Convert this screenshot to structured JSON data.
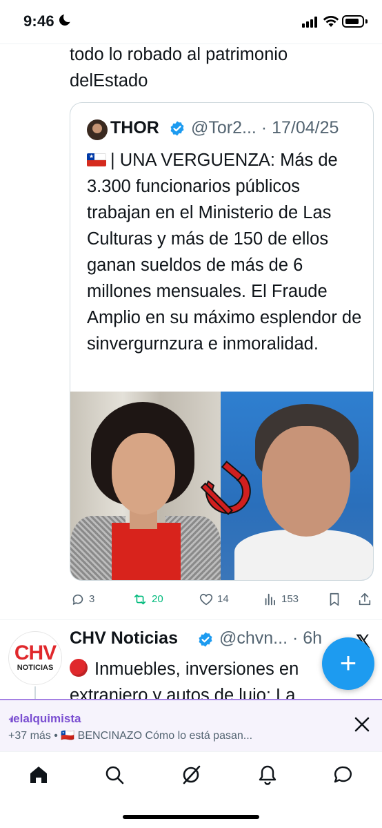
{
  "status_bar": {
    "time": "9:46"
  },
  "tweet": {
    "text_line_1": "todo lo robado al patrimonio",
    "text_line_2": "delEstado",
    "quote": {
      "name": "THOR",
      "handle_date": "@Tor2... · 17/04/25",
      "body": "| UNA VERGUENZA: Más de 3.300 funcionarios públicos trabajan en el Ministerio de Las Culturas y más de 150 de ellos ganan sueldos de más de 6 millones mensuales. El Fraude Amplio en su máximo esplendor de sinvergurnzura e inmoralidad."
    },
    "actions": {
      "replies": "3",
      "reposts": "20",
      "likes": "14",
      "views": "153"
    }
  },
  "next_tweet": {
    "name": "CHV Noticias",
    "handle_time": "@chvn... · 6h",
    "avatar_logo": "CHV",
    "avatar_sub": "NOTICIAS",
    "text_line_1": "Inmuebles, inversiones en",
    "text_line_2": "extranjero y autos de lujo: La"
  },
  "spaces_bar": {
    "host": "elalquimista",
    "subtitle": "+37 más • 🇨🇱 BENCINAZO Cómo lo está pasan..."
  },
  "fab": {
    "label": "+"
  },
  "colors": {
    "accent": "#1d9bf0",
    "repost_green": "#00ba7c",
    "spaces_purple": "#7a4ed1",
    "brand_red": "#e0282c"
  }
}
